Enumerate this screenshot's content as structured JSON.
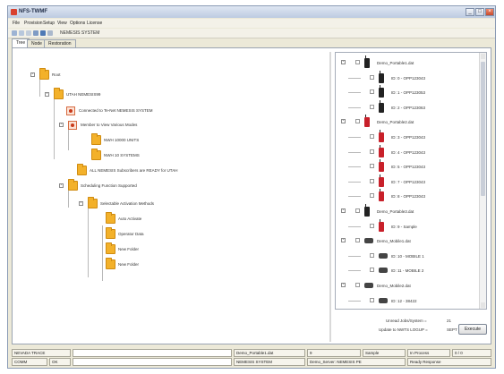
{
  "window": {
    "title": "NFS-TWMF",
    "buttons": [
      "_",
      "□",
      "×"
    ]
  },
  "menu": [
    "File",
    "Provision",
    "Setup",
    "View",
    "Options",
    "License"
  ],
  "toolbar": {
    "label": "NEMESIS SYSTEM"
  },
  "tabs": [
    "Tree",
    "Node",
    "Restoration"
  ],
  "tree": [
    {
      "label": "Root"
    },
    {
      "label": "UTAH NEMESIS99"
    },
    {
      "label": "Connected to Te-Net NEMESIS SYSTEM"
    },
    {
      "label": "Member to View Various Modes"
    },
    {
      "label": "NWH 10000 UNITS"
    },
    {
      "label": "NWH 10 SYSTEMS"
    },
    {
      "label": "ALL NEMESIS Subscribers are READY for UTAH"
    },
    {
      "label": "Scheduling Function Supported"
    },
    {
      "label": "Selectable Activation Methods"
    },
    {
      "label": "Auto Activate"
    },
    {
      "label": "Operator Data"
    },
    {
      "label": "New Folder"
    },
    {
      "label": "New Folder"
    }
  ],
  "devices": [
    {
      "label": "Demo_Portable1.dat",
      "kind": "group-black"
    },
    {
      "label": "ID: 0 - OPP123043",
      "kind": "black"
    },
    {
      "label": "ID: 1 - OPP123053",
      "kind": "black"
    },
    {
      "label": "ID: 2 - OPP123063",
      "kind": "black"
    },
    {
      "label": "Demo_Portable2.dat",
      "kind": "group-red"
    },
    {
      "label": "ID: 3 - OPP123043",
      "kind": "red"
    },
    {
      "label": "ID: 4 - OPP123043",
      "kind": "red"
    },
    {
      "label": "ID: 5 - OPP123043",
      "kind": "red"
    },
    {
      "label": "ID: 7 - OPP123043",
      "kind": "red"
    },
    {
      "label": "ID: 8 - OPP123043",
      "kind": "red"
    },
    {
      "label": "Demo_Portable3.dat",
      "kind": "group-mixed"
    },
    {
      "label": "ID: 9 - Sample",
      "kind": "red"
    },
    {
      "label": "Demo_Mobile1.dat",
      "kind": "group-vehicle"
    },
    {
      "label": "ID: 10 - MOBILE 1",
      "kind": "vehicle"
    },
    {
      "label": "ID: 11 - MOBILE 2",
      "kind": "vehicle"
    },
    {
      "label": "Demo_Mobile2.dat",
      "kind": "group-vehicle"
    },
    {
      "label": "ID: 12 - 38422",
      "kind": "vehicle"
    }
  ],
  "status_info": {
    "line1_label": "Unread Jobs/System =",
    "line1_value": "21",
    "line2_label": "Update to NWTS LOGUP =",
    "line2_value": "SEPT"
  },
  "execute_label": "Execute",
  "statusbar": {
    "row1": [
      "NEVADA TRACE",
      "",
      "Demo_Portable1.dat",
      "9",
      "Sample",
      "In Process",
      "0 / 0"
    ],
    "row2": [
      "COMM",
      "OK",
      "",
      "NEMESIS SYSTEM",
      "Demo_Server: NEMESIS PE",
      "Ready Response"
    ]
  },
  "colors": {
    "folder": "#f3b12a",
    "device_red": "#c8202a",
    "titlebar": "#bccbe1"
  }
}
